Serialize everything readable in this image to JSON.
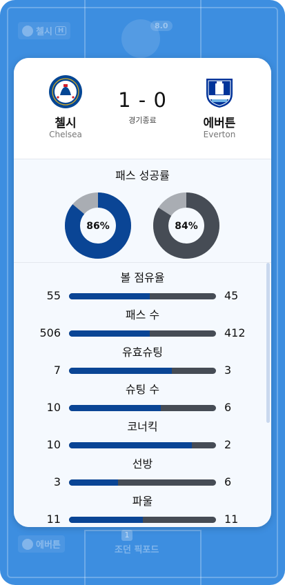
{
  "background": {
    "home_chip": "첼시",
    "home_chip_tag": "H",
    "away_chip": "에버튼",
    "top_player_rating": "8.0",
    "bottom_player_number": "1",
    "bottom_player_name": "조던 픽포드"
  },
  "match": {
    "score": "1 - 0",
    "status": "경기종료",
    "home": {
      "name_ko": "첼시",
      "name_en": "Chelsea",
      "crest_text": "CHELSEA",
      "color": "#034694"
    },
    "away": {
      "name_ko": "에버튼",
      "name_en": "Everton",
      "crest_text": "Everton",
      "color": "#003399"
    }
  },
  "colors": {
    "home": "#0a4595",
    "away": "#464c55",
    "remainder": "#a9adb3"
  },
  "pass_success": {
    "title": "패스 성공률",
    "home_value": 86,
    "home_label": "86%",
    "away_value": 84,
    "away_label": "84%"
  },
  "stats": [
    {
      "label": "볼 점유율",
      "home": 55,
      "away": 45
    },
    {
      "label": "패스 수",
      "home": 506,
      "away": 412
    },
    {
      "label": "유효슈팅",
      "home": 7,
      "away": 3
    },
    {
      "label": "슈팅 수",
      "home": 10,
      "away": 6
    },
    {
      "label": "코너킥",
      "home": 10,
      "away": 2
    },
    {
      "label": "선방",
      "home": 3,
      "away": 6
    },
    {
      "label": "파울",
      "home": 11,
      "away": 11
    }
  ]
}
